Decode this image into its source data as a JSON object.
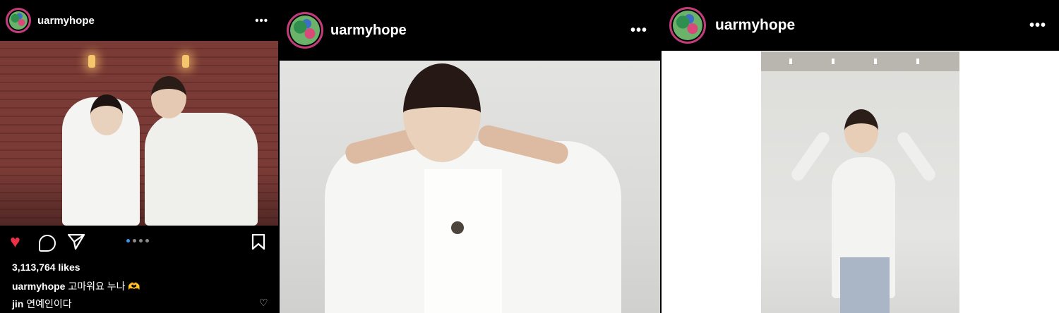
{
  "posts": [
    {
      "username": "uarmyhope",
      "more_label": "•••",
      "likes": "3,113,764 likes",
      "caption_user": "uarmyhope",
      "caption_text": " 고마워요 누나 🫶",
      "comment_user": "jin",
      "comment_text": " 연예인이다",
      "carousel_dots": 4,
      "active_dot": 0
    },
    {
      "username": "uarmyhope",
      "more_label": "•••"
    },
    {
      "username": "uarmyhope",
      "more_label": "•••"
    }
  ],
  "icons": {
    "like": "heart-icon",
    "comment": "comment-icon",
    "share": "paper-plane-icon",
    "save": "bookmark-icon",
    "comment_like": "small-heart-icon"
  },
  "colors": {
    "like_active": "#ed2f4a",
    "carousel_active": "#3897f0",
    "avatar_ring": "#c43a7a"
  }
}
